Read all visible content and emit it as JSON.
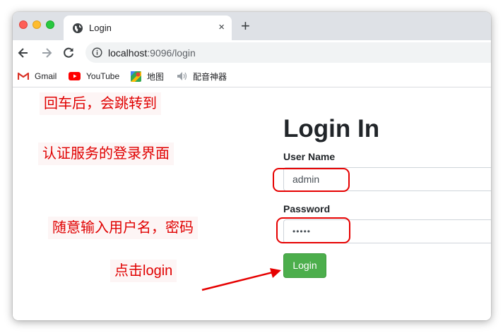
{
  "browser": {
    "tab_title": "Login",
    "tab_close": "×",
    "new_tab": "+",
    "url_host": "localhost",
    "url_rest": ":9096/login"
  },
  "bookmarks": [
    {
      "label": "Gmail",
      "icon": "gmail-icon"
    },
    {
      "label": "YouTube",
      "icon": "youtube-icon"
    },
    {
      "label": "地图",
      "icon": "maps-icon"
    },
    {
      "label": "配音神器",
      "icon": "speaker-icon"
    }
  ],
  "annotations": {
    "step1": "回车后，会跳转到",
    "step2": "认证服务的登录界面",
    "step3": "随意输入用户名，密码",
    "step4": "点击login",
    "color": "#e00000"
  },
  "form": {
    "title": "Login In",
    "username_label": "User Name",
    "username_value": "admin",
    "password_label": "Password",
    "password_value": "•••••",
    "submit_label": "Login",
    "submit_color": "#4cae4c"
  }
}
